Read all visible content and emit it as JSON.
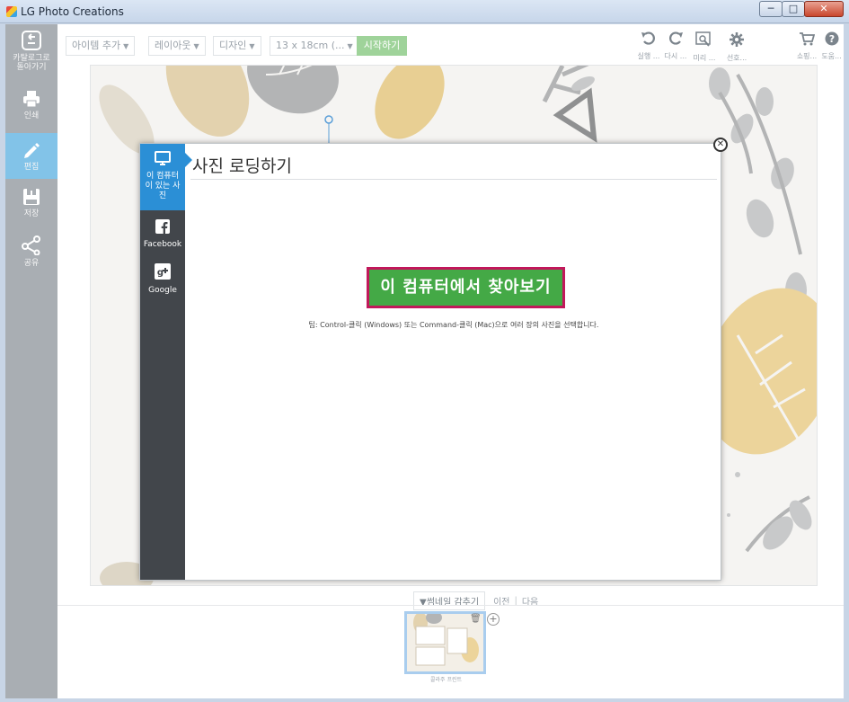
{
  "window": {
    "title": "LG Photo Creations",
    "min_glyph": "─",
    "max_glyph": "□",
    "close_glyph": "✕"
  },
  "rail": {
    "items": [
      {
        "label_line1": "카탈로그로",
        "label_line2": "돌아가기",
        "icon": "back-icon"
      },
      {
        "label_line1": "인쇄",
        "label_line2": "",
        "icon": "printer-icon"
      },
      {
        "label_line1": "편집",
        "label_line2": "",
        "icon": "pencil-icon",
        "active": true
      },
      {
        "label_line1": "저장",
        "label_line2": "",
        "icon": "save-icon"
      },
      {
        "label_line1": "공유",
        "label_line2": "",
        "icon": "share-icon"
      }
    ]
  },
  "toolbar": {
    "add_item": "아이템 추가",
    "layout": "레이아웃",
    "design": "디자인",
    "size": "13 x 18cm (...",
    "start": "시작하기",
    "undo": "실행 ...",
    "redo": "다시 ...",
    "preview": "미리 ...",
    "settings": "선호...",
    "shop": "쇼핑...",
    "help": "도움..."
  },
  "dialog": {
    "title": "사진 로딩하기",
    "tabs": [
      {
        "label_line1": "이 컴퓨터",
        "label_line2": "이 있는 사",
        "label_line3": "진",
        "icon": "monitor-icon",
        "active": true
      },
      {
        "label_line1": "Facebook",
        "icon": "facebook-icon"
      },
      {
        "label_line1": "Google",
        "icon": "google-plus-icon"
      }
    ],
    "browse_button": "이 컴퓨터에서 찾아보기",
    "tip": "팁: Control-클릭 (Windows) 또는 Command-클릭 (Mac)으로 여러 장의 사진을 선택합니다.",
    "close_glyph": "✕"
  },
  "thumbnails": {
    "toggle": "▼썸네일 감추기",
    "prev": "이전",
    "next": "다음",
    "item_label": "콜라주 프린트"
  },
  "colors": {
    "rail_bg": "#a9aeb3",
    "rail_active": "#82c3e8",
    "dialog_side": "#42464b",
    "dialog_tab_active": "#2b8fd6",
    "browse_button": "#44a946",
    "browse_border": "#c2185b",
    "start_button": "#9fd39a"
  }
}
